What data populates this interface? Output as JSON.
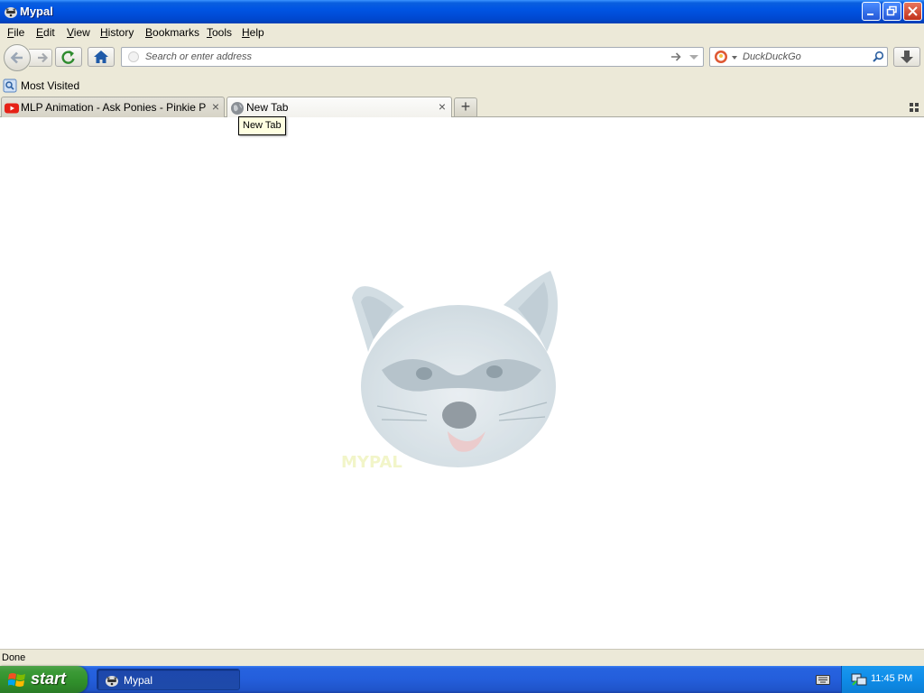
{
  "window": {
    "title": "Mypal"
  },
  "menu": [
    {
      "label": "File",
      "accel": "F",
      "rest": "ile"
    },
    {
      "label": "Edit",
      "accel": "E",
      "rest": "dit"
    },
    {
      "label": "View",
      "accel": "V",
      "rest": "iew"
    },
    {
      "label": "History",
      "accel": "H",
      "rest": "istory"
    },
    {
      "label": "Bookmarks",
      "accel": "B",
      "rest": "ookmarks"
    },
    {
      "label": "Tools",
      "accel": "T",
      "rest": "ools"
    },
    {
      "label": "Help",
      "accel": "H",
      "rest": "elp"
    }
  ],
  "toolbar": {
    "url_placeholder": "Search or enter address",
    "search_placeholder": "DuckDuckGo"
  },
  "bookmarks": {
    "most_visited": "Most Visited"
  },
  "tabs": [
    {
      "label": "MLP Animation - Ask Ponies - Pinkie Pie a...",
      "icon": "youtube-icon",
      "selected": false
    },
    {
      "label": "New Tab",
      "icon": "globe-icon",
      "selected": true
    }
  ],
  "tooltip": "New Tab",
  "status": "Done",
  "taskbar": {
    "start": "start",
    "task": "Mypal",
    "clock": "11:45 PM"
  },
  "colors": {
    "titlebar": "#0054e3",
    "taskbar": "#245edb",
    "start": "#3c9a37",
    "tooltip_bg": "#ffffe1"
  }
}
